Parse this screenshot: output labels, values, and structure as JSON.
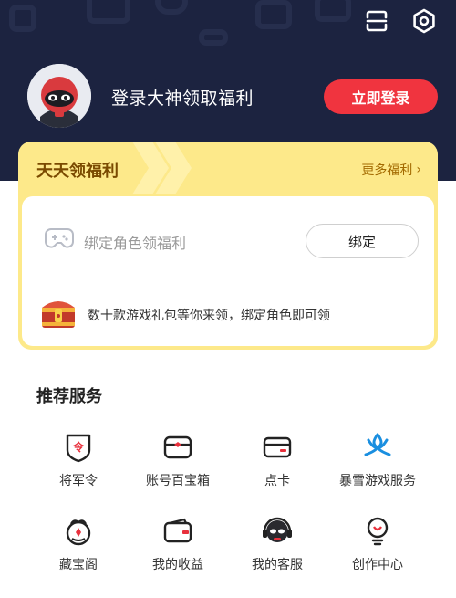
{
  "header": {
    "login_prompt": "登录大神领取福利",
    "login_button": "立即登录"
  },
  "welfare": {
    "title": "天天领福利",
    "more_link": "更多福利",
    "bind_prompt": "绑定角色领福利",
    "bind_button": "绑定",
    "gift_text": "数十款游戏礼包等你来领，绑定角色即可领"
  },
  "services": {
    "title": "推荐服务",
    "items": [
      {
        "label": "将军令",
        "icon": "token-shield-icon"
      },
      {
        "label": "账号百宝箱",
        "icon": "treasure-box-icon"
      },
      {
        "label": "点卡",
        "icon": "card-icon"
      },
      {
        "label": "暴雪游戏服务",
        "icon": "blizzard-icon"
      },
      {
        "label": "藏宝阁",
        "icon": "treasure-pavilion-icon"
      },
      {
        "label": "我的收益",
        "icon": "wallet-icon"
      },
      {
        "label": "我的客服",
        "icon": "customer-service-icon"
      },
      {
        "label": "创作中心",
        "icon": "lightbulb-icon"
      }
    ]
  },
  "colors": {
    "header_bg": "#1c2340",
    "accent_red": "#f0343f",
    "welfare_yellow": "#fde98a",
    "blizzard_blue": "#1a8fe0"
  }
}
